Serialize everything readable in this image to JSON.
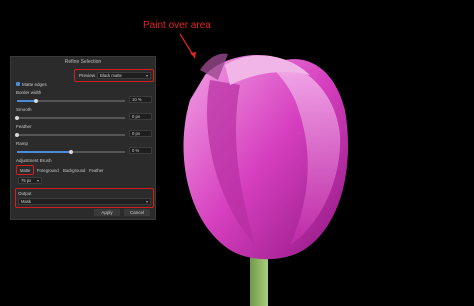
{
  "annotation": {
    "text": "Paint over area",
    "color": "#e12424"
  },
  "dialog": {
    "title": "Refine Selection",
    "preview_label": "Preview",
    "preview_value": "Black matte",
    "matte_edges_label": "Matte edges",
    "border_width": {
      "label": "Border width",
      "value": "10 %",
      "level": 0.18
    },
    "smooth": {
      "label": "Smooth",
      "value": "0 px",
      "level": 0.0
    },
    "feather": {
      "label": "Feather",
      "value": "0 px",
      "level": 0.0
    },
    "ramp": {
      "label": "Ramp",
      "value": "0 %",
      "level": 0.5
    },
    "brush_label": "Adjustment Brush",
    "brush_tabs": [
      "Matte",
      "Foreground",
      "Background",
      "Feather"
    ],
    "brush_size": "75 px",
    "output_label": "Output",
    "output_value": "Mask",
    "apply_label": "Apply",
    "cancel_label": "Cancel"
  },
  "colors": {
    "accent": "#4a8ad8",
    "highlight": "#d41d1d",
    "petal": "#d63fbf"
  }
}
